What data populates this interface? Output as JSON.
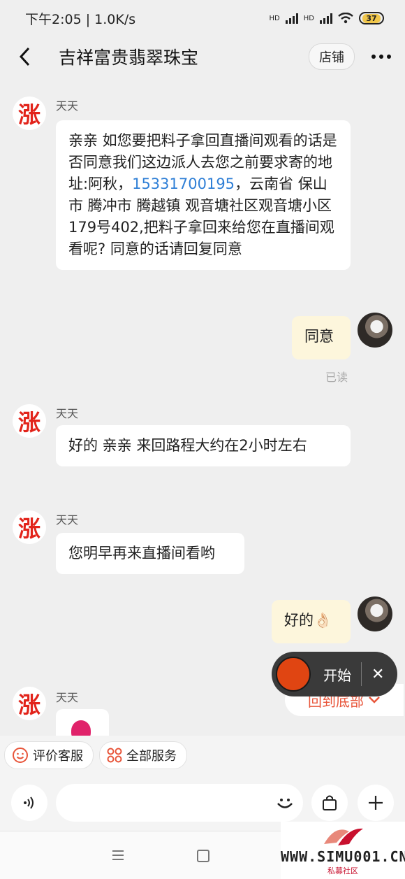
{
  "status_bar": {
    "time_speed": "下午2:05 | 1.0K/s",
    "signal1": "HD",
    "signal2": "HD",
    "battery": "37"
  },
  "header": {
    "title": "吉祥富贵翡翠珠宝",
    "shop_label": "店铺"
  },
  "messages": [
    {
      "side": "left",
      "sender": "天天",
      "avatar_char": "涨",
      "text_before_phone": "亲亲  如您要把料子拿回直播间观看的话是否同意我们这边派人去您之前要求寄的地址:阿秋，",
      "phone": "15331700195",
      "text_after_phone": "，云南省 保山市 腾冲市 腾越镇 观音塘社区观音塘小区179号402,把料子拿回来给您在直播间观看呢? 同意的话请回复同意"
    },
    {
      "side": "right",
      "text": "同意",
      "status": "已读"
    },
    {
      "side": "left",
      "sender": "天天",
      "avatar_char": "涨",
      "text": "好的  亲亲 来回路程大约在2小时左右"
    },
    {
      "side": "left",
      "sender": "天天",
      "avatar_char": "涨",
      "text": "您明早再来直播间看哟"
    },
    {
      "side": "right",
      "text": "好的👌🏻"
    },
    {
      "side": "left",
      "sender": "天天",
      "avatar_char": "涨",
      "type": "sticker"
    }
  ],
  "recorder": {
    "start_label": "开始",
    "close_icon": "close-icon"
  },
  "scroll_bottom_label": "回到底部",
  "quick_actions": [
    {
      "label": "评价客服",
      "icon": "smile-icon"
    },
    {
      "label": "全部服务",
      "icon": "grid-icon"
    }
  ],
  "input_bar": {
    "voice_icon": "voice-icon",
    "emoji_icon": "emoji-icon",
    "bag_icon": "bag-icon",
    "plus_icon": "plus-icon"
  },
  "watermark": {
    "site": "WWW.SIMU001.CN",
    "sub": "私募社区"
  },
  "colors": {
    "accent": "#e8553a",
    "link": "#2f7fd6",
    "bubble_self": "#fdf6dc",
    "logo_red": "#e2231a"
  }
}
